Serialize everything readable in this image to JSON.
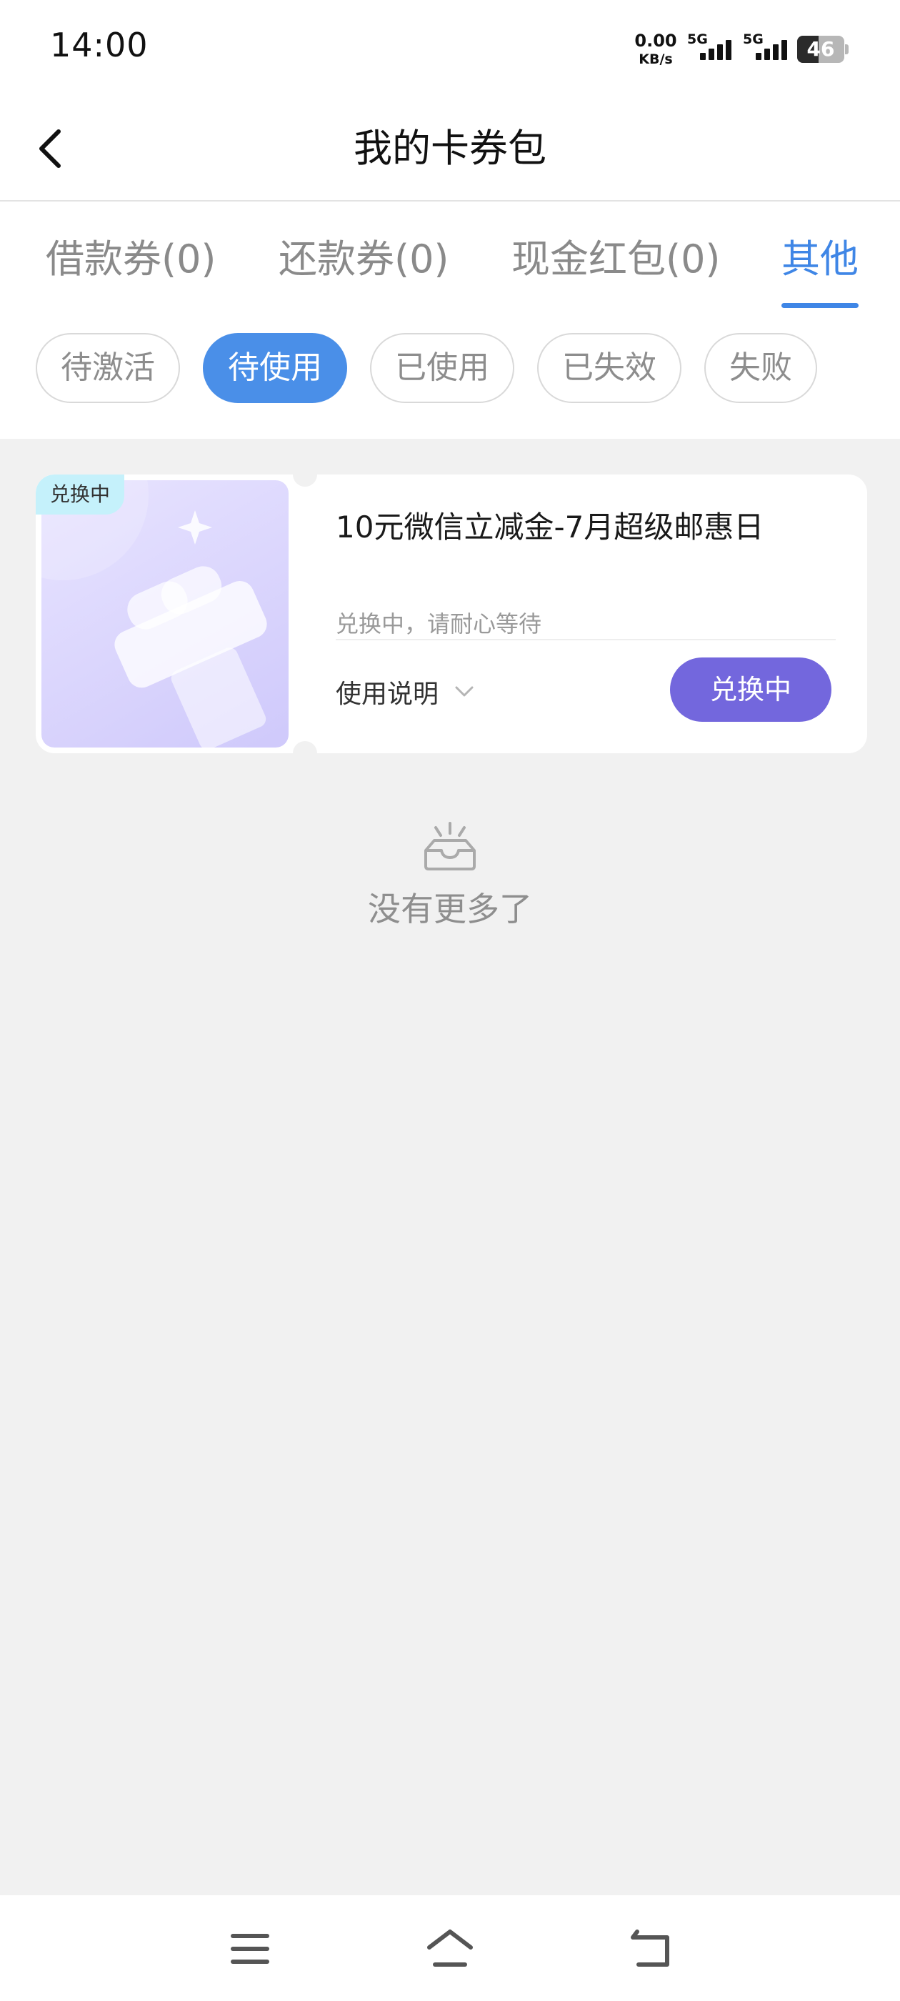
{
  "status_bar": {
    "time": "14:00",
    "net_speed_value": "0.00",
    "net_speed_unit": "KB/s",
    "signal_1_label": "5G",
    "signal_2_label": "5G",
    "battery_level": "46"
  },
  "header": {
    "title": "我的卡券包"
  },
  "tabs": [
    {
      "label": "借款券(0)",
      "active": false
    },
    {
      "label": "还款券(0)",
      "active": false
    },
    {
      "label": "现金红包(0)",
      "active": false
    },
    {
      "label": "其他",
      "active": true
    }
  ],
  "filters": [
    {
      "label": "待激活",
      "active": false
    },
    {
      "label": "待使用",
      "active": true
    },
    {
      "label": "已使用",
      "active": false
    },
    {
      "label": "已失效",
      "active": false
    },
    {
      "label": "失败",
      "active": false
    }
  ],
  "coupon": {
    "status_tag": "兑换中",
    "title": "10元微信立减金-7月超级邮惠日",
    "subtitle": "兑换中，请耐心等待",
    "usage_label": "使用说明",
    "button_label": "兑换中"
  },
  "empty_hint": "没有更多了",
  "colors": {
    "accent": "#3f86e6",
    "pill_active": "#4a8fe8",
    "exchange_button": "#7367dd",
    "status_tag_bg": "#c5f1fb",
    "page_bg": "#f1f1f1"
  },
  "icons": {
    "back": "chevron-left-icon",
    "usage_toggle": "chevron-down-icon",
    "empty": "empty-inbox-icon",
    "thumb": "gift-icon",
    "nav_menu": "menu-icon",
    "nav_home": "home-icon",
    "nav_back": "back-arrow-icon"
  }
}
